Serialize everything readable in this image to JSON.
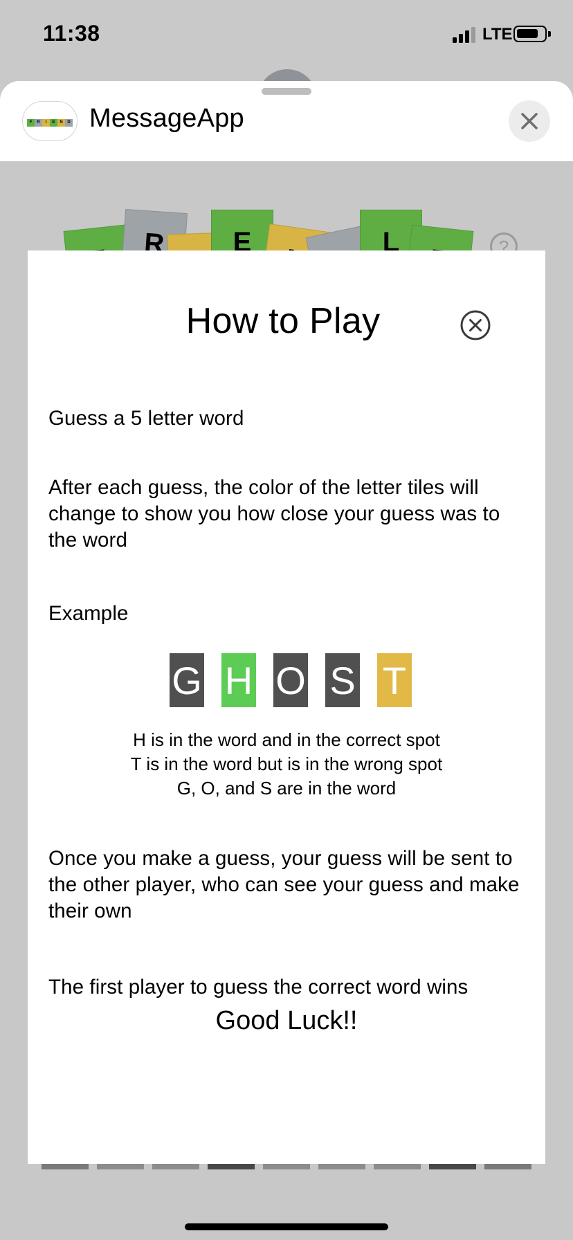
{
  "status_bar": {
    "time": "11:38",
    "network": "LTE"
  },
  "header": {
    "app_name": "MessageApp",
    "app_icon": "friendle-tiles-logo",
    "close_icon": "close-icon"
  },
  "game_logo": {
    "letters": [
      {
        "letter": "F",
        "color": "#5fae44"
      },
      {
        "letter": "R",
        "color": "#9ea3a8"
      },
      {
        "letter": "I",
        "color": "#d8b444"
      },
      {
        "letter": "E",
        "color": "#5fae44"
      },
      {
        "letter": "N",
        "color": "#d8b444"
      },
      {
        "letter": "D",
        "color": "#9ea3a8"
      },
      {
        "letter": "L",
        "color": "#5fae44"
      },
      {
        "letter": "E",
        "color": "#5fae44"
      }
    ],
    "help_icon": "question-circle-icon",
    "help_text": "?"
  },
  "modal": {
    "title": "How to Play",
    "close_icon": "circle-x-icon",
    "intro": "Guess a 5 letter word",
    "color_explanation": "After each guess, the color of the letter tiles will change to show you how close your guess was to the word",
    "example_label": "Example",
    "example_tiles": [
      {
        "letter": "G",
        "state": "absent",
        "color": "#505050"
      },
      {
        "letter": "H",
        "state": "correct",
        "color": "#5ccc54"
      },
      {
        "letter": "O",
        "state": "absent",
        "color": "#505050"
      },
      {
        "letter": "S",
        "state": "absent",
        "color": "#505050"
      },
      {
        "letter": "T",
        "state": "present",
        "color": "#e2b847"
      }
    ],
    "example_lines": [
      "H is in the word and in the correct spot",
      "T is in the word but is in the wrong spot",
      "G, O, and S are in the word"
    ],
    "multiplayer_text": "Once you make a guess, your guess will be sent to the other player, who can see your guess and make their own",
    "win_text": "The first player to guess the correct word wins",
    "closing": "Good Luck!!"
  },
  "colors": {
    "correct": "#5ccc54",
    "present": "#e2b847",
    "absent": "#505050",
    "backdrop": "#c9c9c9"
  }
}
